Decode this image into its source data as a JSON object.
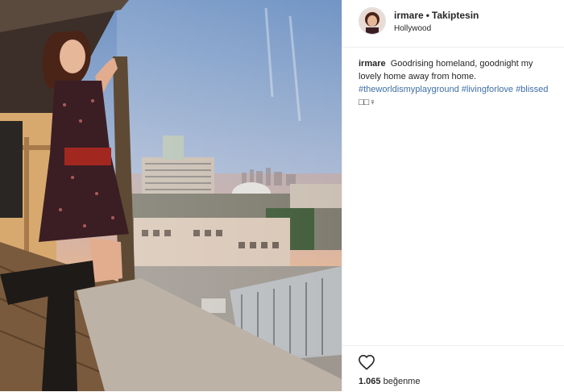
{
  "post": {
    "username": "irmare",
    "separator": "•",
    "follow_label": "Takiptesin",
    "location": "Hollywood",
    "caption": {
      "username": "irmare",
      "text": "Goodrising homeland, goodnight my lovely home away from home.",
      "hashtags": [
        "#theworldismyplayground",
        "#livingforlove",
        "#blissed"
      ],
      "emoji_tail": "□□♀"
    },
    "likes_count": "1.065",
    "likes_label": "beğenme"
  },
  "icons": {
    "like": "heart-outline-icon"
  },
  "colors": {
    "hashtag": "#3f6ea5",
    "text": "#262626",
    "divider": "#efefef"
  }
}
